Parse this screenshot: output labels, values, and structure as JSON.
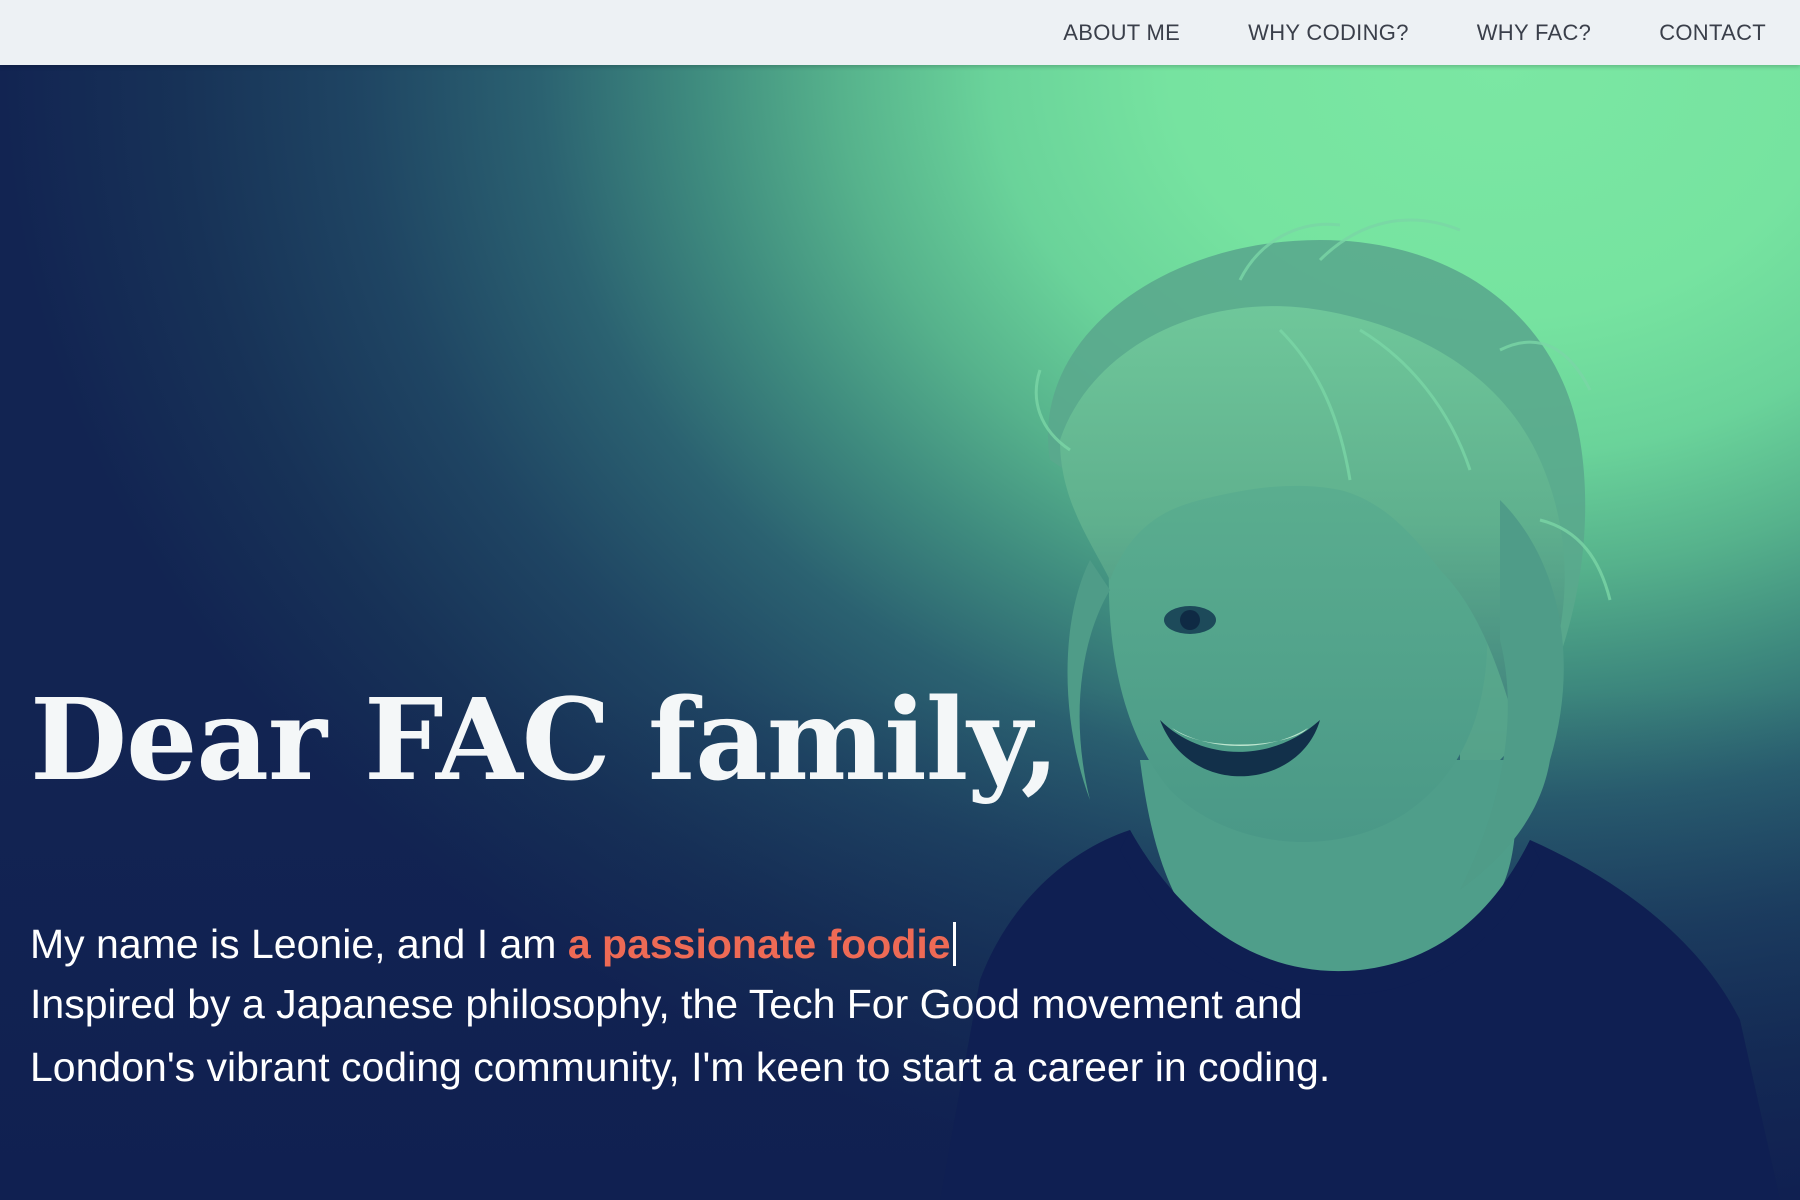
{
  "nav": {
    "items": [
      {
        "label": "ABOUT ME"
      },
      {
        "label": "WHY CODING?"
      },
      {
        "label": "WHY FAC?"
      },
      {
        "label": "CONTACT"
      }
    ]
  },
  "hero": {
    "title": "Dear FAC family,",
    "intro_prefix": "My name is Leonie, and I am ",
    "intro_typed": "a passionate foodie",
    "body": "Inspired by a Japanese philosophy, the Tech For Good movement and London's vibrant coding community, I'm keen to start a career in coding."
  },
  "colors": {
    "accent": "#ee6a55",
    "nav_background": "#edf1f4",
    "hero_green": "#7be7a3",
    "hero_navy": "#0f1d4f"
  }
}
